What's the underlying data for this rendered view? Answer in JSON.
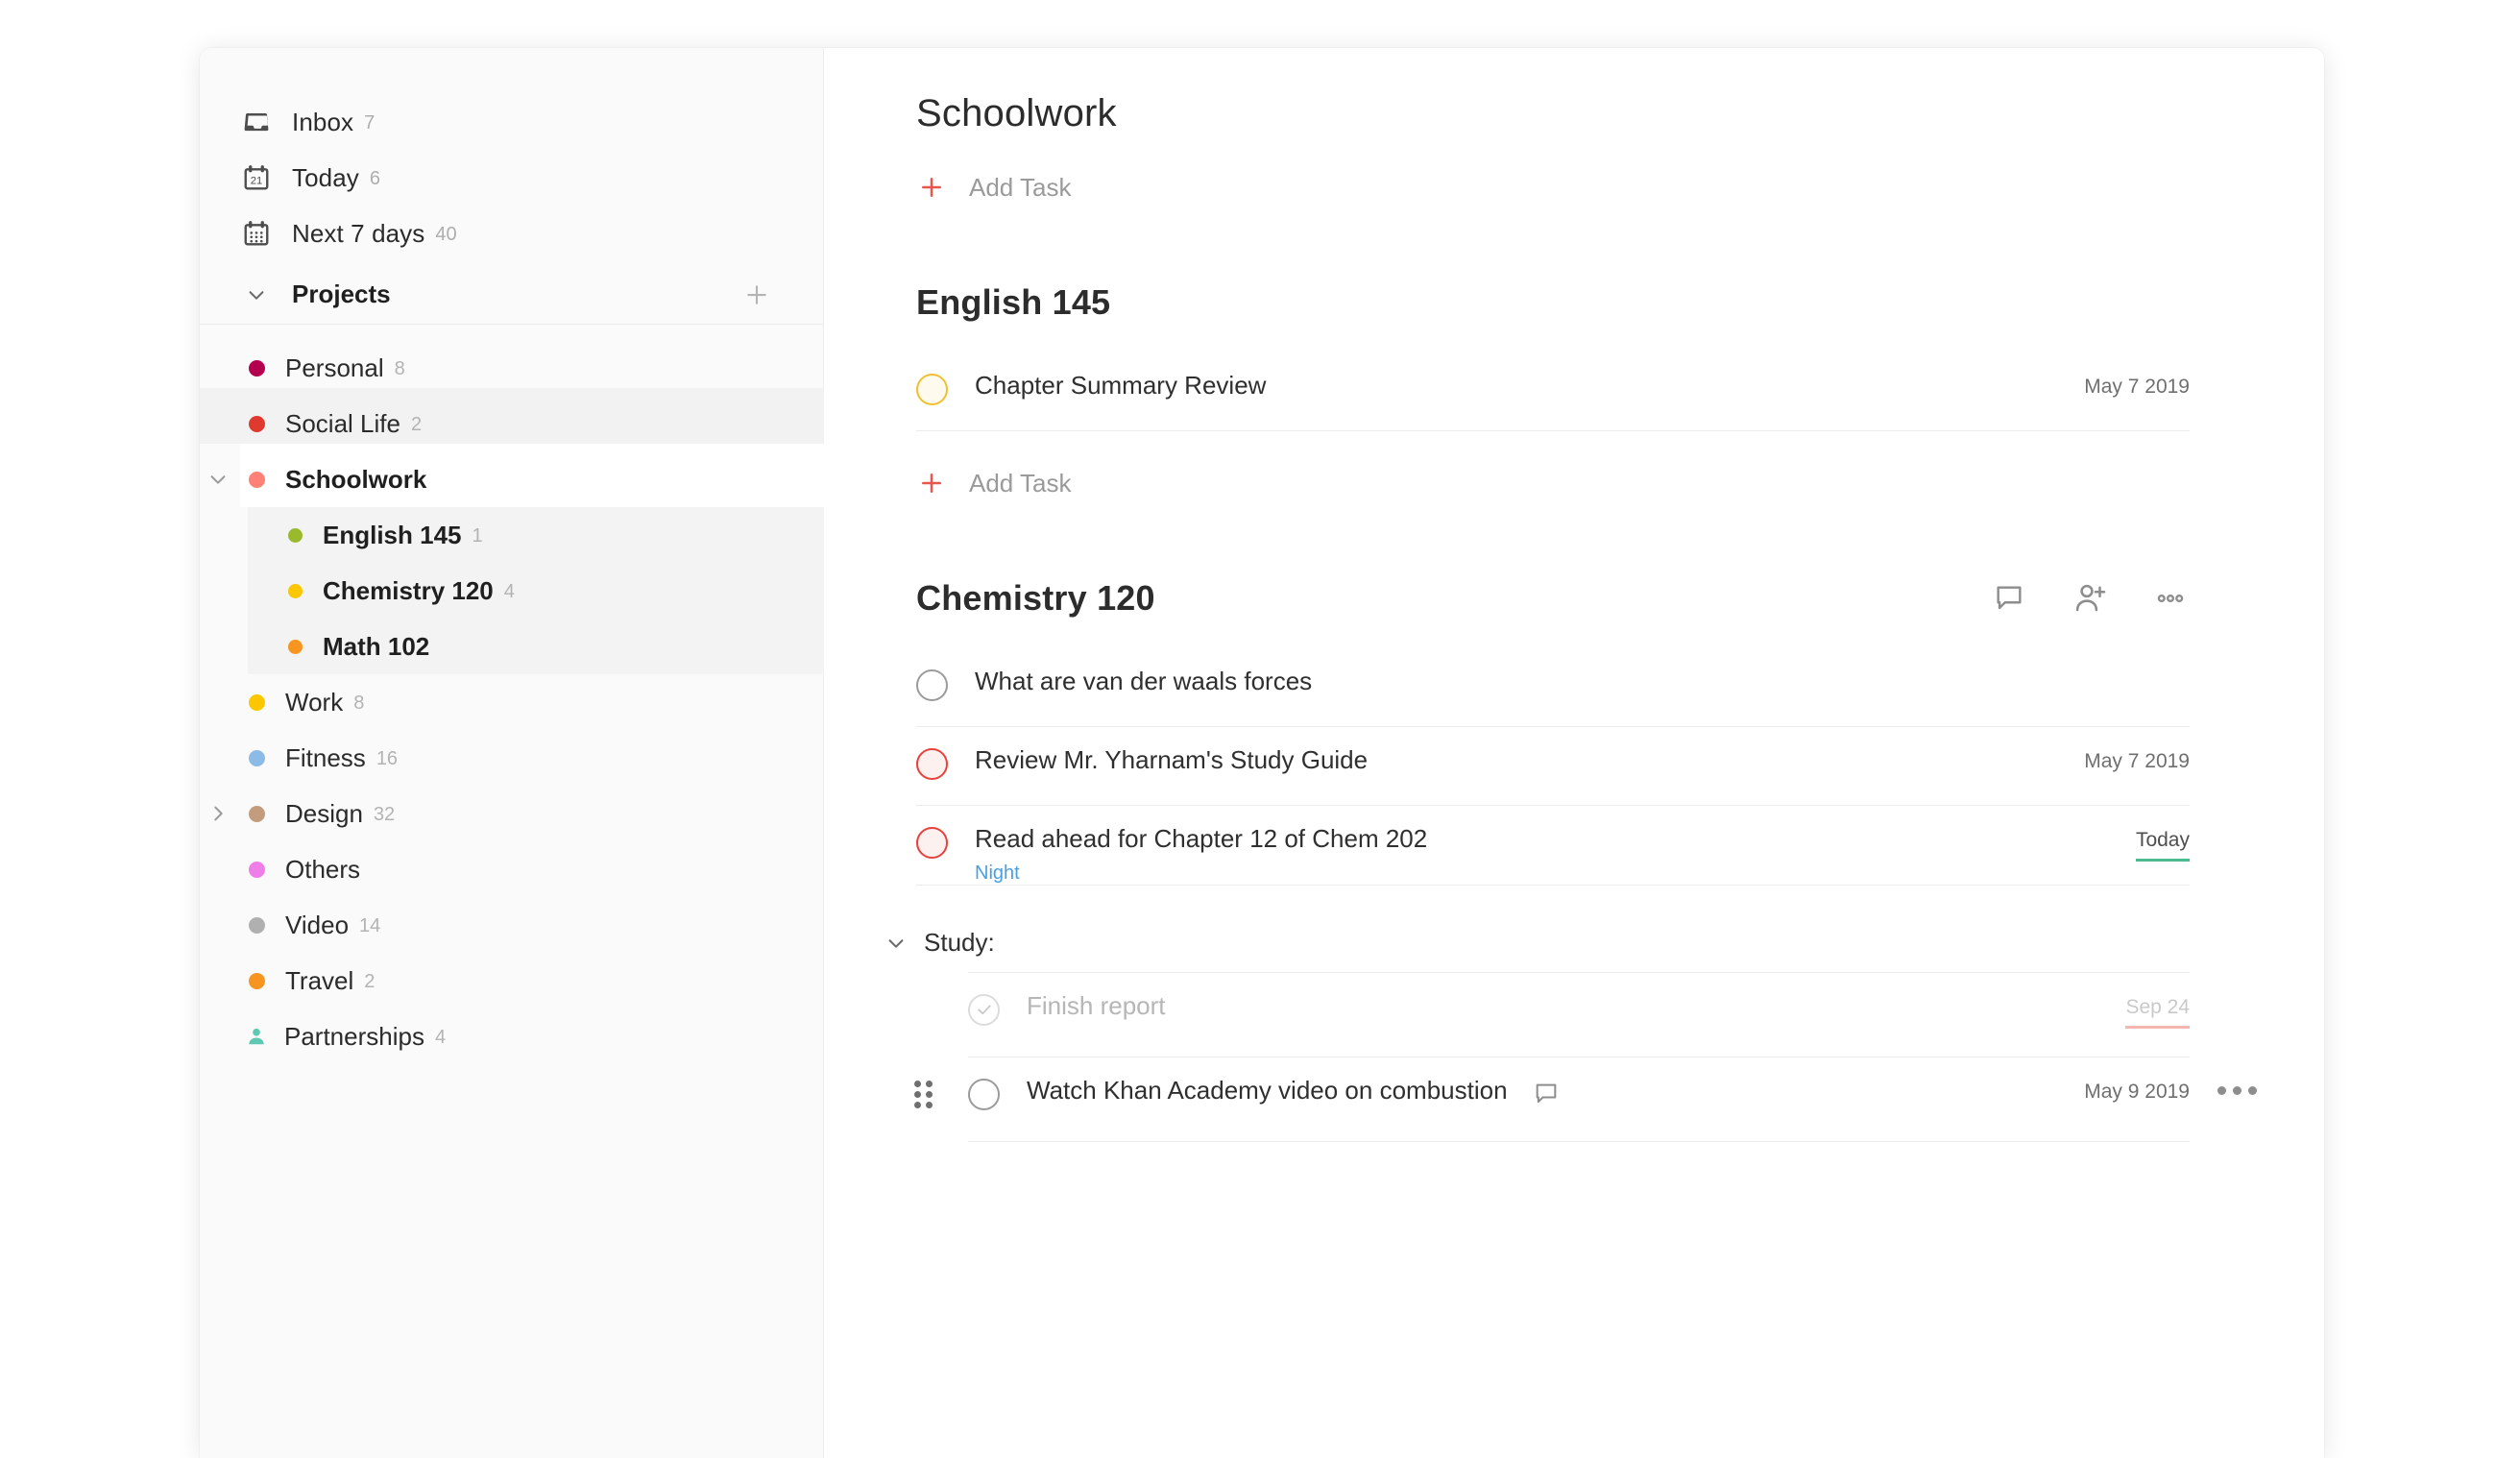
{
  "sidebar": {
    "nav": [
      {
        "label": "Inbox",
        "count": "7",
        "icon": "inbox-icon"
      },
      {
        "label": "Today",
        "count": "6",
        "icon": "calendar-today-icon"
      },
      {
        "label": "Next 7 days",
        "count": "40",
        "icon": "calendar-week-icon"
      }
    ],
    "projects_header": {
      "label": "Projects",
      "caret": "chevron-down-icon",
      "add": "plus-icon"
    },
    "projects": [
      {
        "label": "Personal",
        "count": "8",
        "color": "#b4004e",
        "level": 0,
        "bold": false,
        "caret": "",
        "icon": "dot"
      },
      {
        "label": "Social Life",
        "count": "2",
        "color": "#e03a30",
        "level": 0,
        "bold": false,
        "caret": "",
        "icon": "dot"
      },
      {
        "label": "Schoolwork",
        "count": "",
        "color": "#ff8077",
        "level": 0,
        "bold": true,
        "caret": "chevron-down-icon",
        "icon": "dot"
      },
      {
        "label": "English 145",
        "count": "1",
        "color": "#9aba2e",
        "level": 1,
        "bold": true,
        "caret": "",
        "icon": "dot"
      },
      {
        "label": "Chemistry 120",
        "count": "4",
        "color": "#fbc700",
        "level": 1,
        "bold": true,
        "caret": "",
        "icon": "dot"
      },
      {
        "label": "Math 102",
        "count": "",
        "color": "#f89520",
        "level": 1,
        "bold": true,
        "caret": "",
        "icon": "dot"
      },
      {
        "label": "Work",
        "count": "8",
        "color": "#fbc700",
        "level": 0,
        "bold": false,
        "caret": "",
        "icon": "dot"
      },
      {
        "label": "Fitness",
        "count": "16",
        "color": "#8cbbe8",
        "level": 0,
        "bold": false,
        "caret": "",
        "icon": "dot"
      },
      {
        "label": "Design",
        "count": "32",
        "color": "#c39c7e",
        "level": 0,
        "bold": false,
        "caret": "chevron-right-icon",
        "icon": "dot"
      },
      {
        "label": "Others",
        "count": "",
        "color": "#ef7ee8",
        "level": 0,
        "bold": false,
        "caret": "",
        "icon": "dot"
      },
      {
        "label": "Video",
        "count": "14",
        "color": "#b0b0b0",
        "level": 0,
        "bold": false,
        "caret": "",
        "icon": "dot"
      },
      {
        "label": "Travel",
        "count": "2",
        "color": "#f89520",
        "level": 0,
        "bold": false,
        "caret": "",
        "icon": "dot"
      },
      {
        "label": "Partnerships",
        "count": "4",
        "color": "#5ec9b0",
        "level": 0,
        "bold": false,
        "caret": "",
        "icon": "person"
      }
    ]
  },
  "main": {
    "page_title": "Schoolwork",
    "add_task_label": "Add Task",
    "sections": [
      {
        "title": "English 145",
        "has_actions": false,
        "add_task_label": "Add Task",
        "tasks": [
          {
            "title": "Chapter Summary Review",
            "meta": "May 7 2019",
            "meta_state": "normal",
            "check": "yellow",
            "sub": "",
            "comment": false
          }
        ],
        "group": null
      },
      {
        "title": "Chemistry 120",
        "has_actions": true,
        "actions": [
          "comment-icon",
          "add-person-icon",
          "more-icon"
        ],
        "add_task_label": "",
        "tasks": [
          {
            "title": "What are van der waals forces",
            "meta": "",
            "meta_state": "normal",
            "check": "empty",
            "sub": "",
            "comment": false
          },
          {
            "title": "Review Mr. Yharnam's Study Guide",
            "meta": "May 7 2019",
            "meta_state": "normal",
            "check": "red",
            "sub": "",
            "comment": false
          },
          {
            "title": "Read ahead for Chapter 12 of Chem 202",
            "meta": "Today",
            "meta_state": "today",
            "check": "red",
            "sub": "Night",
            "comment": false
          }
        ],
        "group": {
          "title": "Study:",
          "caret": "chevron-down-icon",
          "tasks": [
            {
              "title": "Finish report",
              "meta": "Sep 24",
              "meta_state": "overdue",
              "check": "done",
              "sub": "",
              "comment": false,
              "drag": false,
              "menu": false
            },
            {
              "title": "Watch Khan Academy video on combustion",
              "meta": "May 9 2019",
              "meta_state": "normal",
              "check": "empty",
              "sub": "",
              "comment": true,
              "drag": true,
              "menu": true
            }
          ]
        }
      }
    ]
  },
  "colors": {
    "accent_red": "#e8574c",
    "due_today_green": "#4cba8f",
    "overdue_red": "#f2b7b1",
    "sub_label_blue": "#4a9fe0"
  }
}
